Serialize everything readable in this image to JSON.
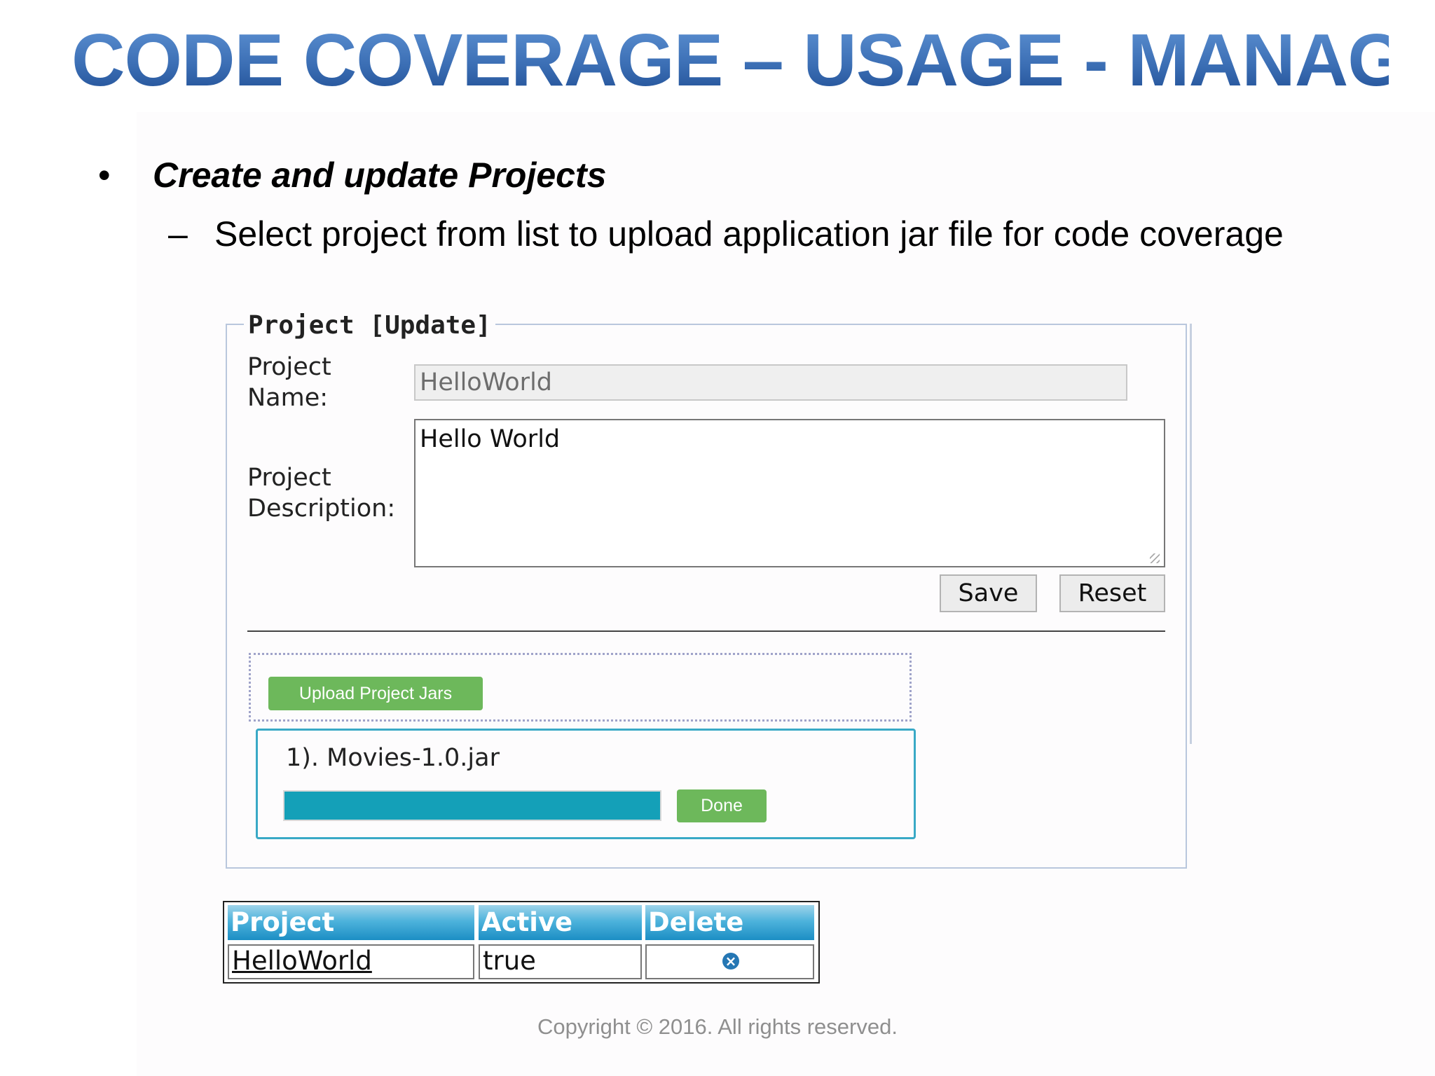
{
  "slide": {
    "title": "CODE COVERAGE – USAGE - MANAGER",
    "bullet": "Create and update Projects",
    "sub_bullet": "Select project from list to upload application jar file for code coverage",
    "copyright": "Copyright © 2016. All rights reserved."
  },
  "form": {
    "legend": "Project [Update]",
    "name_label_line1": "Project",
    "name_label_line2": "Name:",
    "name_value": "HelloWorld",
    "desc_label_line1": "Project",
    "desc_label_line2": "Description:",
    "desc_value": "Hello World",
    "save_label": "Save",
    "reset_label": "Reset"
  },
  "upload": {
    "button_label": "Upload Project Jars",
    "file_entry": "1). Movies-1.0.jar",
    "progress_fraction": 1.0,
    "status_label": "Done"
  },
  "table": {
    "headers": [
      "Project",
      "Active",
      "Delete"
    ],
    "rows": [
      {
        "project": "HelloWorld",
        "active": "true",
        "delete_icon": "delete-circle-x-icon"
      }
    ]
  },
  "colors": {
    "title_blue": "#3f73b9",
    "accent_green": "#6db85b",
    "progress_teal": "#14a0b8",
    "header_blue": "#4eb3dc"
  }
}
